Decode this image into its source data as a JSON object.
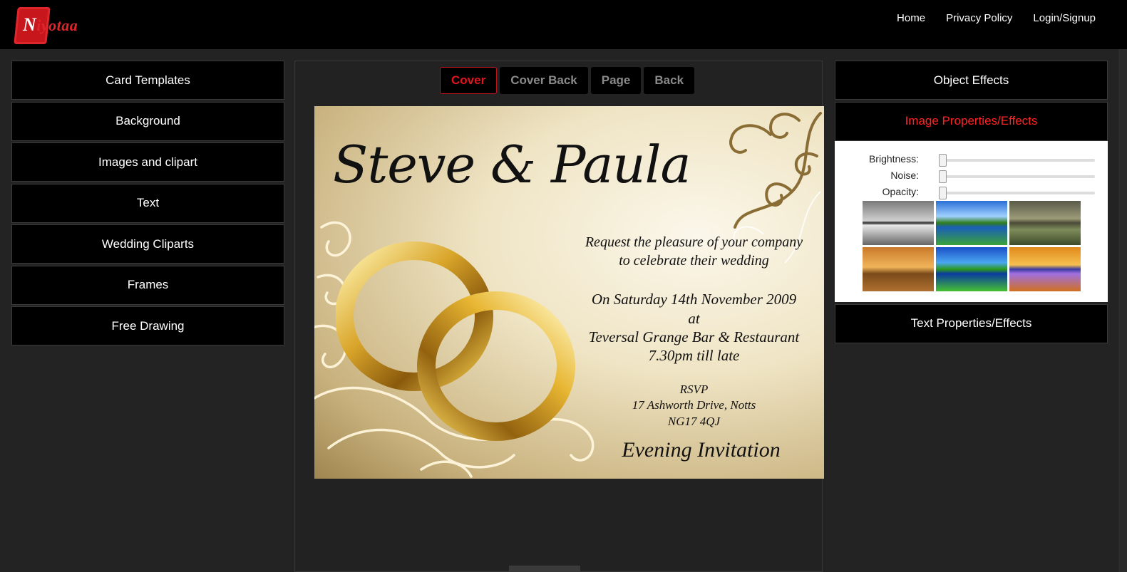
{
  "brand": {
    "initial": "N",
    "rest": "iyotaa"
  },
  "nav": [
    "Home",
    "Privacy Policy",
    "Login/Signup"
  ],
  "left_menu": [
    "Card Templates",
    "Background",
    "Images and clipart",
    "Text",
    "Wedding Cliparts",
    "Frames",
    "Free Drawing"
  ],
  "tabs": [
    {
      "label": "Cover",
      "active": true
    },
    {
      "label": "Cover Back",
      "active": false
    },
    {
      "label": "Page",
      "active": false
    },
    {
      "label": "Back",
      "active": false
    }
  ],
  "card": {
    "names": "Steve & Paula",
    "line1": "Request the pleasure of your company",
    "line2": "to celebrate their wedding",
    "date": "On Saturday 14th November 2009",
    "at": "at",
    "venue": "Teversal Grange Bar & Restaurant",
    "time": "7.30pm till late",
    "rsvp": "RSVP",
    "address": "17 Ashworth Drive, Notts",
    "postcode": "NG17 4QJ",
    "footer": "Evening Invitation"
  },
  "right_panel": {
    "object_effects": "Object Effects",
    "image_props": "Image Properties/Effects",
    "text_props": "Text Properties/Effects",
    "sliders": [
      {
        "label": "Brightness:",
        "value": 0
      },
      {
        "label": "Noise:",
        "value": 0
      },
      {
        "label": "Opacity:",
        "value": 0
      }
    ],
    "thumbnails": [
      "grayscale",
      "original",
      "vintage",
      "sepia",
      "saturated",
      "inverted"
    ]
  },
  "colors": {
    "accent_red": "#e0161e",
    "bg": "#232323",
    "panel": "#000000"
  }
}
